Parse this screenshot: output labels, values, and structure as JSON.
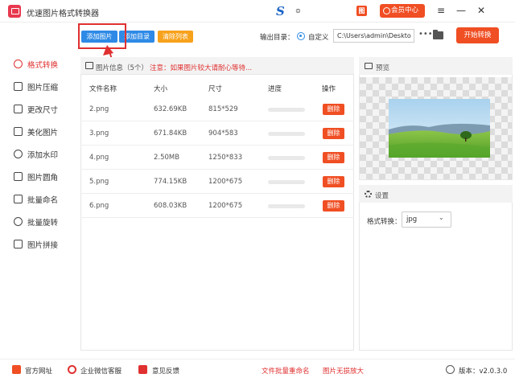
{
  "app": {
    "title": "优速图片格式转换器",
    "brand_logo": "S",
    "brand_mark": "⊜"
  },
  "titlebar": {
    "red_icon": "图",
    "vip_label": "会员中心",
    "controls": {
      "menu": "≡",
      "minimize": "—",
      "close": "✕"
    }
  },
  "toolbar": {
    "add_image": "添加图片",
    "add_dir": "添加目录",
    "clear_list": "清除列表",
    "output_label": "输出目录：",
    "custom_label": "自定义",
    "output_path": "C:\\Users\\admin\\Deskto",
    "more": "•••",
    "start": "开始转换"
  },
  "sidebar": {
    "items": [
      {
        "label": "格式转换",
        "icon": "format-icon",
        "active": true
      },
      {
        "label": "图片压缩",
        "icon": "compress-icon",
        "active": false
      },
      {
        "label": "更改尺寸",
        "icon": "resize-icon",
        "active": false
      },
      {
        "label": "美化图片",
        "icon": "beautify-icon",
        "active": false
      },
      {
        "label": "添加水印",
        "icon": "watermark-icon",
        "active": false
      },
      {
        "label": "图片圆角",
        "icon": "round-corner-icon",
        "active": false
      },
      {
        "label": "批量命名",
        "icon": "rename-icon",
        "active": false
      },
      {
        "label": "批量旋转",
        "icon": "rotate-icon",
        "active": false
      },
      {
        "label": "图片拼接",
        "icon": "splice-icon",
        "active": false
      }
    ]
  },
  "files": {
    "header_title": "图片信息（5个）",
    "header_note": "注意：如果图片较大请耐心等待...",
    "columns": {
      "name": "文件名称",
      "size": "大小",
      "dims": "尺寸",
      "progress": "进度",
      "action": "操作"
    },
    "rows": [
      {
        "name": "2.png",
        "size": "632.69KB",
        "dims": "815*529",
        "progress": 0,
        "delete": "删除"
      },
      {
        "name": "3.png",
        "size": "671.84KB",
        "dims": "904*583",
        "progress": 0,
        "delete": "删除"
      },
      {
        "name": "4.png",
        "size": "2.50MB",
        "dims": "1250*833",
        "progress": 0,
        "delete": "删除"
      },
      {
        "name": "5.png",
        "size": "774.15KB",
        "dims": "1200*675",
        "progress": 0,
        "delete": "删除"
      },
      {
        "name": "6.png",
        "size": "608.03KB",
        "dims": "1200*675",
        "progress": 0,
        "delete": "删除"
      }
    ]
  },
  "preview": {
    "title": "预览"
  },
  "settings": {
    "title": "设置",
    "format_label": "格式转换：",
    "format_value": "jpg"
  },
  "footer": {
    "website": "官方网址",
    "wechat": "企业微信客服",
    "feedback": "意见反馈",
    "batch_rename": "文件批量重命名",
    "lossless": "图片无损放大",
    "version": "版本：v2.0.3.0"
  },
  "colors": {
    "accent_red": "#f04e23",
    "accent_blue": "#2e8ae6",
    "accent_orange": "#f7a21c"
  }
}
